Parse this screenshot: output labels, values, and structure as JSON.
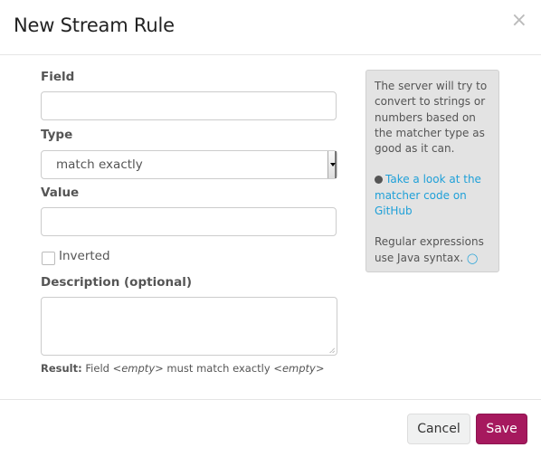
{
  "dialog": {
    "title": "New Stream Rule",
    "close_label": "×"
  },
  "form": {
    "field_label": "Field",
    "field_value": "",
    "type_label": "Type",
    "type_selected": "match exactly",
    "value_label": "Value",
    "value_value": "",
    "inverted_label": "Inverted",
    "inverted_checked": false,
    "description_label": "Description (optional)",
    "description_value": "",
    "result_label": "Result:",
    "result_text_1": " Field ",
    "result_field": "<empty>",
    "result_text_2": " must match exactly ",
    "result_value": "<empty>"
  },
  "help": {
    "paragraph1": "The server will try to convert to strings or numbers based on the matcher type as good as it can.",
    "github_link": "Take a look at the matcher code on GitHub",
    "paragraph3": "Regular expressions use Java syntax.",
    "icons": [
      "github-icon",
      "lightbulb-icon"
    ]
  },
  "footer": {
    "cancel_label": "Cancel",
    "save_label": "Save"
  },
  "colors": {
    "primary": "#a6195e",
    "link": "#1fa0d8",
    "help_bg": "#e3e3e3"
  }
}
